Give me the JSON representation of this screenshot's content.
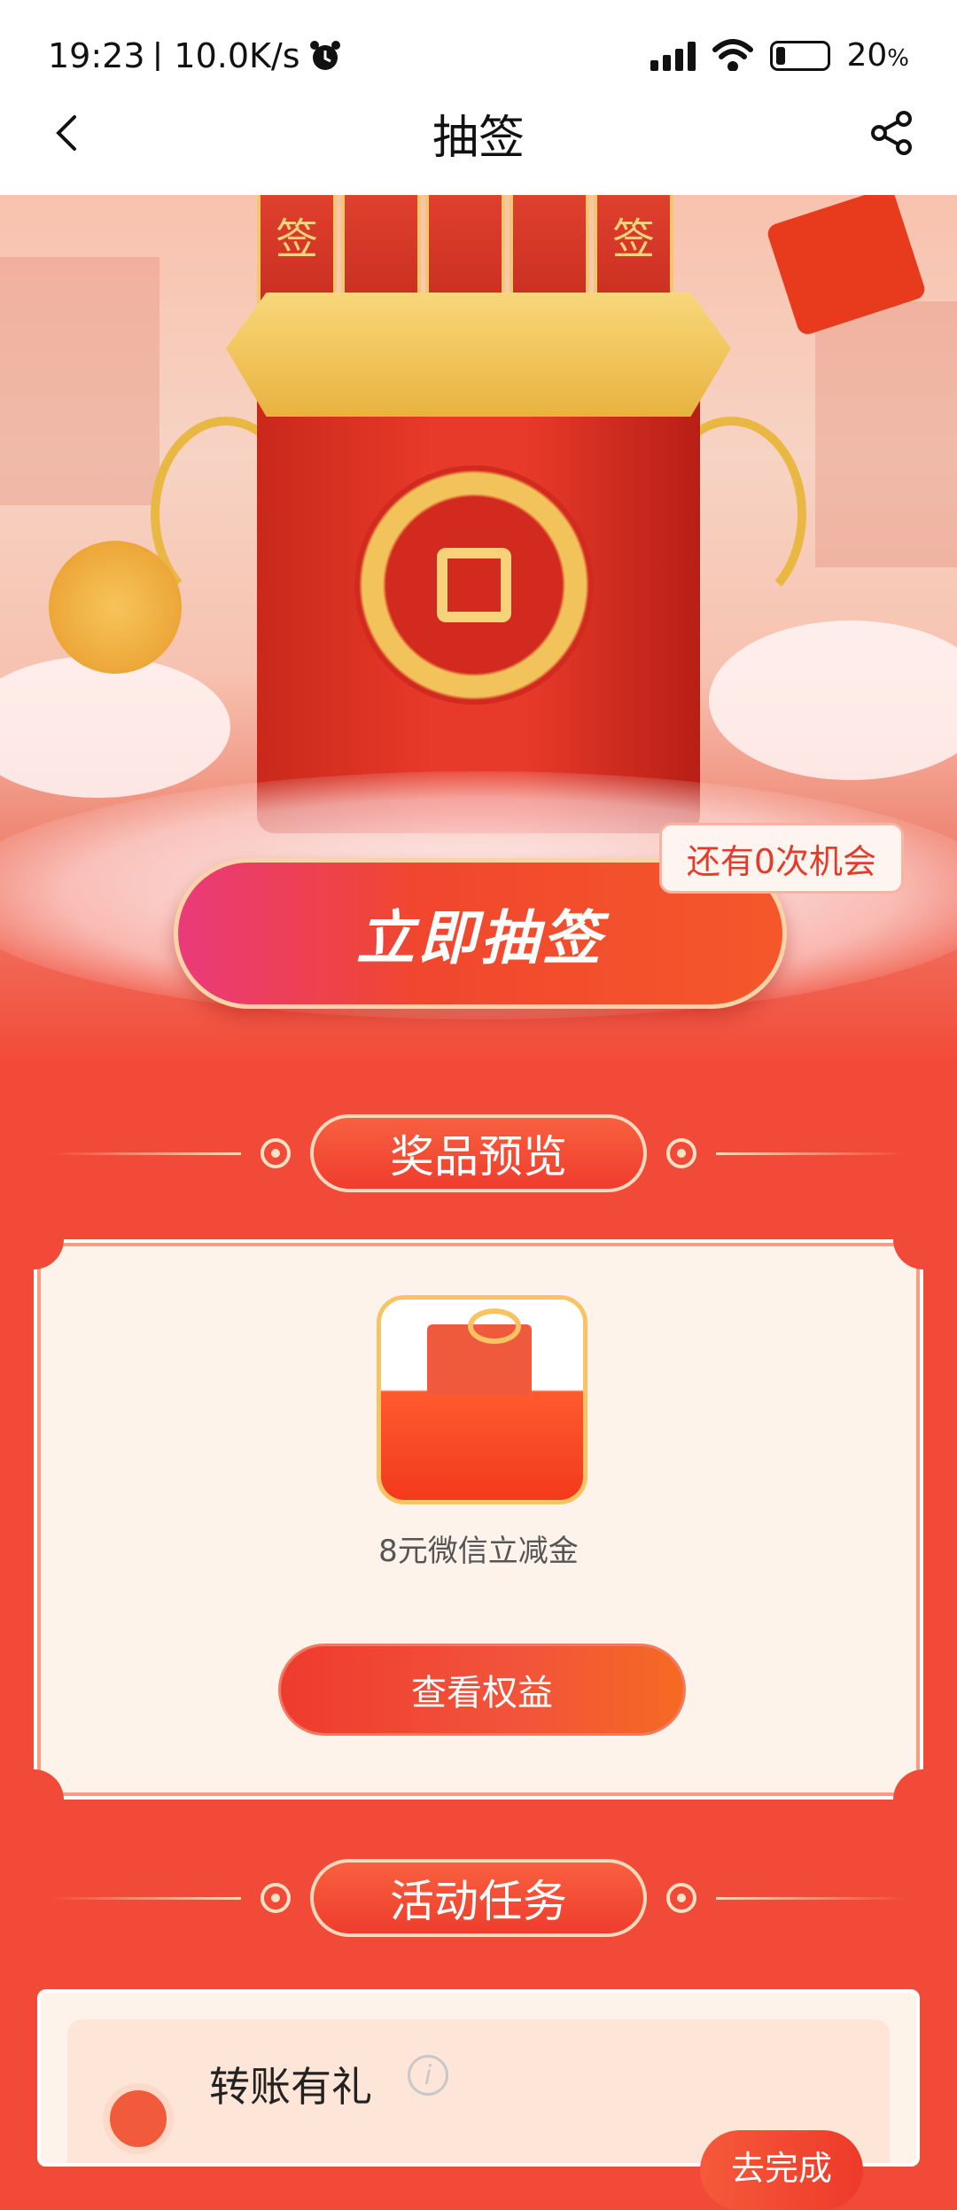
{
  "status_bar": {
    "time": "19:23",
    "net_speed": "| 10.0K/s",
    "battery_percent": "20",
    "battery_unit": "%",
    "battery_level": 0.2
  },
  "nav": {
    "title": "抽签",
    "back_icon": "chevron-left-icon",
    "share_icon": "share-icon"
  },
  "hero": {
    "stick_labels": [
      "签",
      "签"
    ],
    "chances_text": "还有0次机会",
    "draw_button_label": "立即抽签"
  },
  "prizes": {
    "section_title": "奖品预览",
    "items": [
      {
        "name": "8元微信立减金"
      }
    ],
    "view_button_label": "查看权益"
  },
  "tasks": {
    "section_title": "活动任务",
    "items": [
      {
        "title": "转账有礼",
        "button_label": "去完成"
      }
    ]
  },
  "colors": {
    "primary_red": "#f24a38",
    "gold": "#f6d27a",
    "card_bg": "#fdf3ea"
  }
}
